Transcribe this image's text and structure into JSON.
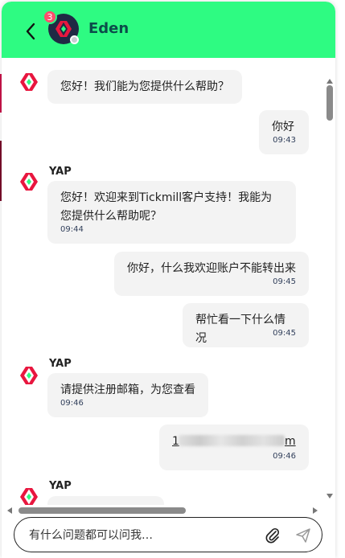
{
  "header": {
    "agent_name": "Eden",
    "unread_count": "3",
    "background": "#2efb82"
  },
  "messages": [
    {
      "direction": "in",
      "show_logo": true,
      "sender": "",
      "lines": [
        "您好！我们能为您提供什么帮助？"
      ],
      "time": ""
    },
    {
      "direction": "out",
      "lines": [
        "你好"
      ],
      "time": "09:43"
    },
    {
      "direction": "in",
      "show_logo": true,
      "sender": "YAP",
      "lines": [
        "您好！欢迎来到Tickmill客户支持！我能为",
        "您提供什么帮助呢？"
      ],
      "time": "09:44"
    },
    {
      "direction": "out",
      "lines": [
        "你好，什么我欢迎账户不能转出来"
      ],
      "time": "09:45"
    },
    {
      "direction": "out",
      "lines": [
        "帮忙看一下什么情况"
      ],
      "time": "09:45"
    },
    {
      "direction": "in",
      "show_logo": true,
      "sender": "YAP",
      "lines": [
        "请提供注册邮箱，为您查看"
      ],
      "time": "09:46"
    },
    {
      "direction": "out",
      "lines": [
        "1",
        "m"
      ],
      "redacted": true,
      "time": "09:46"
    },
    {
      "direction": "in",
      "show_logo": true,
      "sender": "YAP",
      "lines": [],
      "time": ""
    }
  ],
  "composer": {
    "placeholder": "有什么问题都可以问我…",
    "attach_icon": "paperclip-icon",
    "send_icon": "send-icon"
  },
  "colors": {
    "brand_red": "#e8173f",
    "brand_green": "#2efb82",
    "bubble": "#f3f3f3",
    "avatar_bg": "#1f2a44"
  }
}
